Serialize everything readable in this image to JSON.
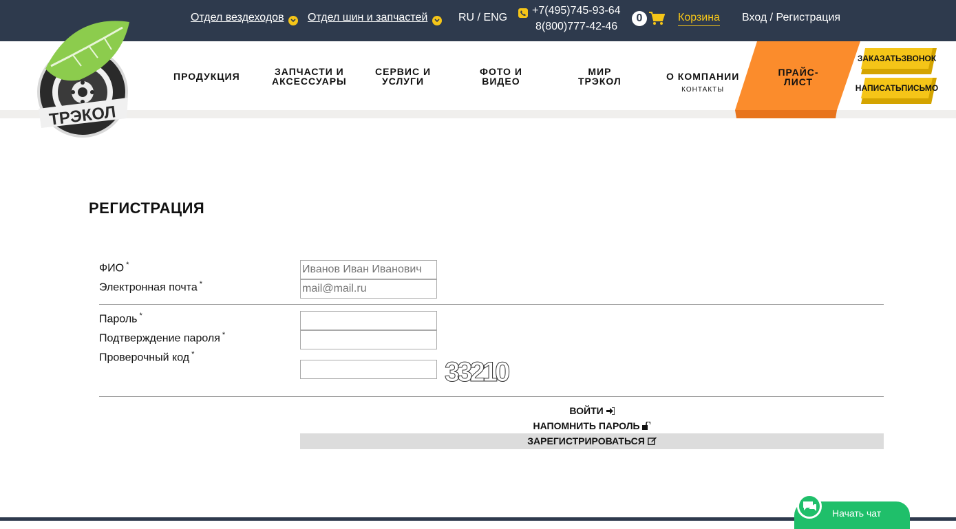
{
  "topbar": {
    "dept_vehicles": "Отдел вездеходов",
    "dept_tires": "Отдел шин и запчастей",
    "lang": "RU / ENG",
    "phone1": "+7(495)745-93-64",
    "phone2": "8(800)777-42-46",
    "cart_count": "0",
    "cart_label": "Корзина",
    "login": "Вход / Регистрация"
  },
  "nav": {
    "products": "ПРОДУКЦИЯ",
    "parts_l1": "ЗАПЧАСТИ И",
    "parts_l2": "АКСЕССУАРЫ",
    "service_l1": "СЕРВИС И",
    "service_l2": "УСЛУГИ",
    "photo_l1": "ФОТО И",
    "photo_l2": "ВИДЕО",
    "world_l1": "МИР",
    "world_l2": "ТРЭКОЛ",
    "about": "О КОМПАНИИ",
    "contacts": "КОНТАКТЫ",
    "price_l1": "ПРАЙС-",
    "price_l2": "ЛИСТ",
    "callback_l1": "ЗАКАЗАТЬ",
    "callback_l2": "ЗВОНОК",
    "letter_l1": "НАПИСАТЬ",
    "letter_l2": "ПИСЬМО"
  },
  "logo": {
    "text": "ТРЭКОЛ"
  },
  "form": {
    "title": "РЕГИСТРАЦИЯ",
    "required_mark": "*",
    "fio_label": "ФИО",
    "fio_placeholder": "Иванов Иван Иванович",
    "email_label": "Электронная почта",
    "email_placeholder": "mail@mail.ru",
    "password_label": "Пароль",
    "confirm_label": "Подтверждение пароля",
    "captcha_label": "Проверочный код",
    "captcha_text": "33210",
    "login_action": "ВОЙТИ",
    "remind_action": "НАПОМНИТЬ ПАРОЛЬ",
    "register_action": "ЗАРЕГИСТРИРОВАТЬСЯ"
  },
  "chat": {
    "label": "Начать чат"
  },
  "colors": {
    "topbar": "#2e3a4d",
    "accent": "#f5c518",
    "price_orange": "#fb8c2c",
    "chat_green": "#1fbf6a"
  }
}
